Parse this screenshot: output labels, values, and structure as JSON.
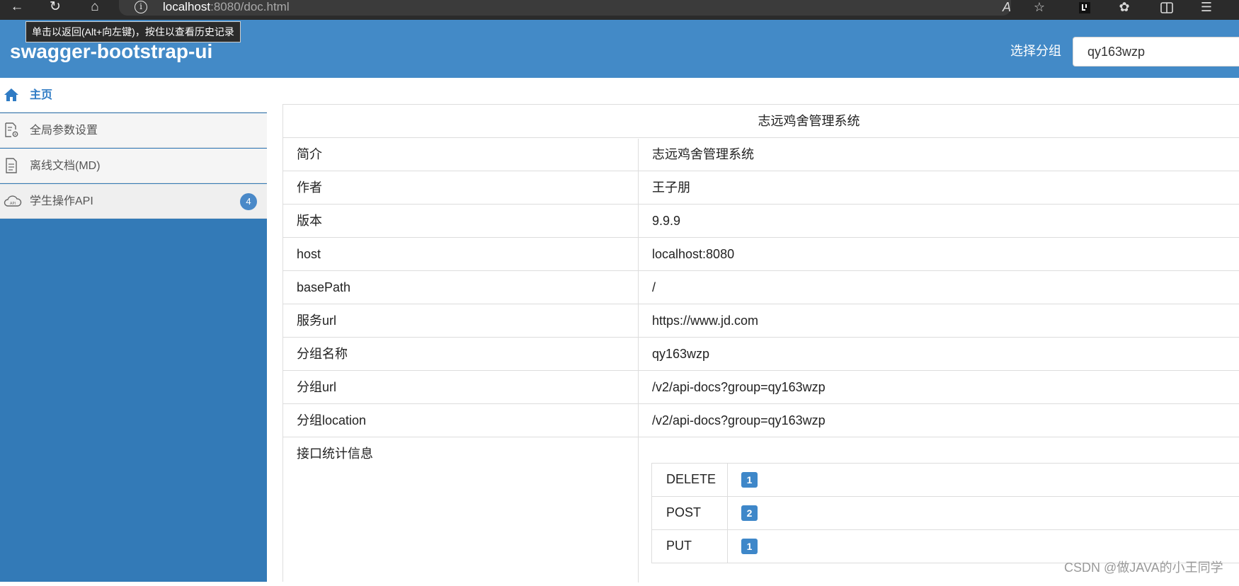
{
  "browser": {
    "url_host": "localhost",
    "url_path": ":8080/doc.html",
    "tooltip": "单击以返回(Alt+向左键)，按住以查看历史记录",
    "read_aloud_label": "A"
  },
  "header": {
    "brand": "swagger-bootstrap-ui",
    "group_label": "选择分组",
    "group_value": "qy163wzp"
  },
  "sidebar": {
    "items": [
      {
        "label": "主页",
        "icon": "home-icon"
      },
      {
        "label": "全局参数设置",
        "icon": "settings-document-icon"
      },
      {
        "label": "离线文档(MD)",
        "icon": "document-icon"
      },
      {
        "label": "学生操作API",
        "icon": "api-cloud-icon",
        "badge": "4"
      }
    ]
  },
  "info": {
    "title": "志远鸡舍管理系统",
    "rows": [
      {
        "key": "简介",
        "value": "志远鸡舍管理系统"
      },
      {
        "key": "作者",
        "value": "王子朋"
      },
      {
        "key": "版本",
        "value": "9.9.9"
      },
      {
        "key": "host",
        "value": "localhost:8080"
      },
      {
        "key": "basePath",
        "value": "/"
      },
      {
        "key": "服务url",
        "value": "https://www.jd.com"
      },
      {
        "key": "分组名称",
        "value": "qy163wzp"
      },
      {
        "key": "分组url",
        "value": "/v2/api-docs?group=qy163wzp"
      },
      {
        "key": "分组location",
        "value": "/v2/api-docs?group=qy163wzp"
      }
    ],
    "stats_label": "接口统计信息",
    "stats": [
      {
        "method": "DELETE",
        "count": "1"
      },
      {
        "method": "POST",
        "count": "2"
      },
      {
        "method": "PUT",
        "count": "1"
      }
    ]
  },
  "watermark": "CSDN @做JAVA的小王同学",
  "colors": {
    "header_blue": "#438ac7",
    "sidebar_blue": "#337ab7",
    "badge_blue": "#3e87c9"
  }
}
